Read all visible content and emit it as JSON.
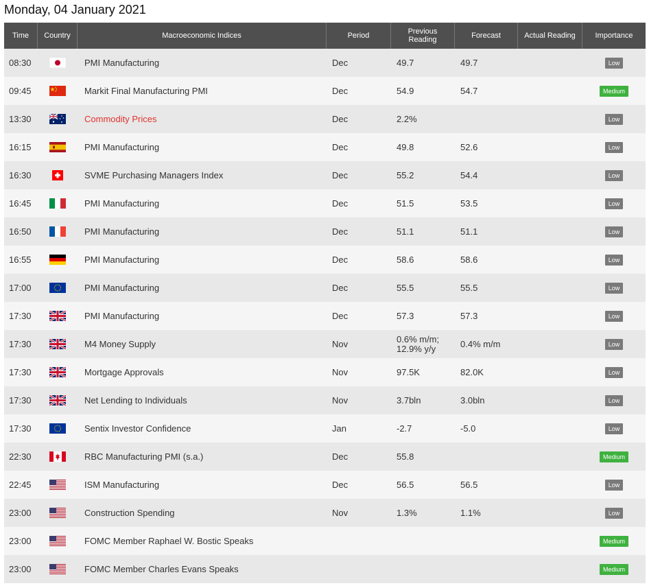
{
  "title": "Monday, 04 January 2021",
  "headers": {
    "time": "Time",
    "country": "Country",
    "index": "Macroeconomic Indices",
    "period": "Period",
    "previous_line1": "Previous",
    "previous_line2": "Reading",
    "forecast": "Forecast",
    "actual": "Actual Reading",
    "importance": "Importance"
  },
  "colors": {
    "low": "#7a7a7a",
    "medium": "#3fb13f",
    "header": "#4f4f4f",
    "red_text": "#e0322d"
  },
  "rows": [
    {
      "time": "08:30",
      "country": "japan-flag",
      "index": "PMI Manufacturing",
      "period": "Dec",
      "previous": "49.7",
      "forecast": "49.7",
      "actual": "",
      "importance": "Low"
    },
    {
      "time": "09:45",
      "country": "china-flag",
      "index": "Markit Final Manufacturing PMI",
      "period": "Dec",
      "previous": "54.9",
      "forecast": "54.7",
      "actual": "",
      "importance": "Medium"
    },
    {
      "time": "13:30",
      "country": "australia-flag",
      "index": "Commodity Prices",
      "period": "Dec",
      "previous": "2.2%",
      "forecast": "",
      "actual": "",
      "importance": "Low",
      "highlight": true
    },
    {
      "time": "16:15",
      "country": "spain-flag",
      "index": "PMI Manufacturing",
      "period": "Dec",
      "previous": "49.8",
      "forecast": "52.6",
      "actual": "",
      "importance": "Low"
    },
    {
      "time": "16:30",
      "country": "switzerland-flag",
      "index": "SVME Purchasing Managers Index",
      "period": "Dec",
      "previous": "55.2",
      "forecast": "54.4",
      "actual": "",
      "importance": "Low"
    },
    {
      "time": "16:45",
      "country": "italy-flag",
      "index": "PMI Manufacturing",
      "period": "Dec",
      "previous": "51.5",
      "forecast": "53.5",
      "actual": "",
      "importance": "Low"
    },
    {
      "time": "16:50",
      "country": "france-flag",
      "index": "PMI Manufacturing",
      "period": "Dec",
      "previous": "51.1",
      "forecast": "51.1",
      "actual": "",
      "importance": "Low"
    },
    {
      "time": "16:55",
      "country": "germany-flag",
      "index": "PMI Manufacturing",
      "period": "Dec",
      "previous": "58.6",
      "forecast": "58.6",
      "actual": "",
      "importance": "Low"
    },
    {
      "time": "17:00",
      "country": "eu-flag",
      "index": "PMI Manufacturing",
      "period": "Dec",
      "previous": "55.5",
      "forecast": "55.5",
      "actual": "",
      "importance": "Low"
    },
    {
      "time": "17:30",
      "country": "uk-flag",
      "index": "PMI Manufacturing",
      "period": "Dec",
      "previous": "57.3",
      "forecast": "57.3",
      "actual": "",
      "importance": "Low"
    },
    {
      "time": "17:30",
      "country": "uk-flag",
      "index": "M4 Money Supply",
      "period": "Nov",
      "previous": "0.6% m/m; 12.9% y/y",
      "forecast": "0.4% m/m",
      "actual": "",
      "importance": "Low"
    },
    {
      "time": "17:30",
      "country": "uk-flag",
      "index": "Mortgage Approvals",
      "period": "Nov",
      "previous": "97.5K",
      "forecast": "82.0K",
      "actual": "",
      "importance": "Low"
    },
    {
      "time": "17:30",
      "country": "uk-flag",
      "index": "Net Lending to Individuals",
      "period": "Nov",
      "previous": "3.7bln",
      "forecast": "3.0bln",
      "actual": "",
      "importance": "Low"
    },
    {
      "time": "17:30",
      "country": "eu-flag",
      "index": "Sentix Investor Confidence",
      "period": "Jan",
      "previous": "-2.7",
      "forecast": "-5.0",
      "actual": "",
      "importance": "Low"
    },
    {
      "time": "22:30",
      "country": "canada-flag",
      "index": "RBC Manufacturing PMI (s.a.)",
      "period": "Dec",
      "previous": "55.8",
      "forecast": "",
      "actual": "",
      "importance": "Medium"
    },
    {
      "time": "22:45",
      "country": "usa-flag",
      "index": "ISM Manufacturing",
      "period": "Dec",
      "previous": "56.5",
      "forecast": "56.5",
      "actual": "",
      "importance": "Low"
    },
    {
      "time": "23:00",
      "country": "usa-flag",
      "index": "Construction Spending",
      "period": "Nov",
      "previous": "1.3%",
      "forecast": "1.1%",
      "actual": "",
      "importance": "Low"
    },
    {
      "time": "23:00",
      "country": "usa-flag",
      "index": "FOMC Member Raphael W. Bostic Speaks",
      "period": "",
      "previous": "",
      "forecast": "",
      "actual": "",
      "importance": "Medium"
    },
    {
      "time": "23:00",
      "country": "usa-flag",
      "index": "FOMC Member Charles Evans Speaks",
      "period": "",
      "previous": "",
      "forecast": "",
      "actual": "",
      "importance": "Medium"
    }
  ]
}
